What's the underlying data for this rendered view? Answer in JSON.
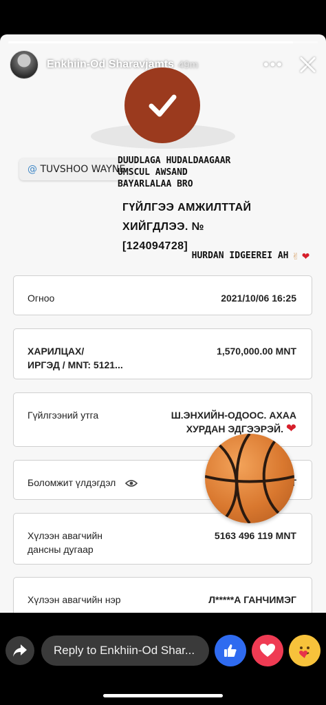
{
  "story": {
    "author": "Enkhiin-Od Sharavjamts",
    "time_ago": "49m",
    "progress": 0.92,
    "mention_tag": "TUVSHOO WAYNE",
    "mention_prefix": "@",
    "caption_lines": [
      "DUUDLAGA HUDALDAAGAAR",
      "UMSCUL AWSAND",
      "BAYARLALAA BRO"
    ],
    "note_text": "HURDAN IDGEEREI AH"
  },
  "receipt": {
    "title": "ГҮЙЛГЭЭ АМЖИЛТТАЙ ХИЙГДЛЭЭ. №",
    "number": "[124094728]",
    "date_label": "Огноо",
    "date_value": "2021/10/06 16:25",
    "account_label_line1": "ХАРИЛЦАХ/",
    "account_label_line2": "ИРГЭД / MNT: 5121...",
    "amount_value": "1,570,000.00 MNT",
    "purpose_label": "Гүйлгээний утга",
    "purpose_value_line1": "Ш.ЭНХИЙН-ОДООС. АХАА",
    "purpose_value_line2": "ХУРДАН ЭДГЭЭРЭЙ.",
    "balance_label": "Боломжит үлдэгдэл",
    "balance_value_tail": "Т",
    "recipient_account_label_line1": "Хүлээн авагчийн",
    "recipient_account_label_line2": "дансны дугаар",
    "recipient_account_value": "5163 496 119 MNT",
    "recipient_name_label": "Хүлээн авагчийн нэр",
    "recipient_name_value": "Л*****А ГАНЧИМЭГ"
  },
  "footer": {
    "reply_placeholder": "Reply to Enkhiin-Od Shar..."
  },
  "colors": {
    "check_circle": "#9b3a1e",
    "like": "#2f6bf0",
    "love": "#ef3b53",
    "care": "#f7c23b",
    "mention_at": "#3d86c6"
  },
  "icons": [
    "more-icon",
    "close-icon",
    "check-icon",
    "eye-icon",
    "basketball-icon",
    "heart-icon",
    "hand-icon",
    "share-icon",
    "like-icon",
    "love-icon",
    "care-icon"
  ]
}
